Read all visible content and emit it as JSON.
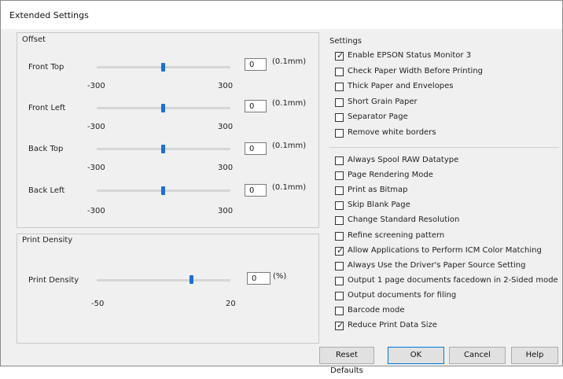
{
  "window": {
    "title": "Extended Settings"
  },
  "offset": {
    "label": "Offset",
    "unit": "(0.1mm)",
    "range_min": "-300",
    "range_max": "300",
    "rows": [
      {
        "label": "Front Top",
        "value": "0",
        "slider_fraction": 0.5
      },
      {
        "label": "Front Left",
        "value": "0",
        "slider_fraction": 0.5
      },
      {
        "label": "Back Top",
        "value": "0",
        "slider_fraction": 0.5
      },
      {
        "label": "Back Left",
        "value": "0",
        "slider_fraction": 0.5
      }
    ]
  },
  "print_density": {
    "group_label": "Print Density",
    "label": "Print Density",
    "value": "0",
    "unit": "(%)",
    "range_min": "-50",
    "range_max": "20",
    "slider_fraction": 0.714
  },
  "settings": {
    "label": "Settings",
    "group1": [
      {
        "label": "Enable EPSON Status Monitor 3",
        "checked": true
      },
      {
        "label": "Check Paper Width Before Printing",
        "checked": false
      },
      {
        "label": "Thick Paper and Envelopes",
        "checked": false
      },
      {
        "label": "Short Grain Paper",
        "checked": false
      },
      {
        "label": "Separator Page",
        "checked": false
      },
      {
        "label": "Remove white borders",
        "checked": false
      }
    ],
    "group2": [
      {
        "label": "Always Spool RAW Datatype",
        "checked": false
      },
      {
        "label": "Page Rendering Mode",
        "checked": false
      },
      {
        "label": "Print as Bitmap",
        "checked": false
      },
      {
        "label": "Skip Blank Page",
        "checked": false
      },
      {
        "label": "Change Standard Resolution",
        "checked": false
      },
      {
        "label": "Refine screening pattern",
        "checked": false
      },
      {
        "label": "Allow Applications to Perform ICM Color Matching",
        "checked": true
      },
      {
        "label": "Always Use the Driver's Paper Source Setting",
        "checked": false
      },
      {
        "label": "Output 1 page documents facedown in 2-Sided mode",
        "checked": false
      },
      {
        "label": "Output documents for filing",
        "checked": false
      },
      {
        "label": "Barcode mode",
        "checked": false
      },
      {
        "label": "Reduce Print Data Size",
        "checked": true
      }
    ]
  },
  "buttons": {
    "reset": "Reset Defaults",
    "ok": "OK",
    "cancel": "Cancel",
    "help": "Help"
  },
  "colors": {
    "accent": "#1f6fd1",
    "focus_border": "#0078d7"
  }
}
